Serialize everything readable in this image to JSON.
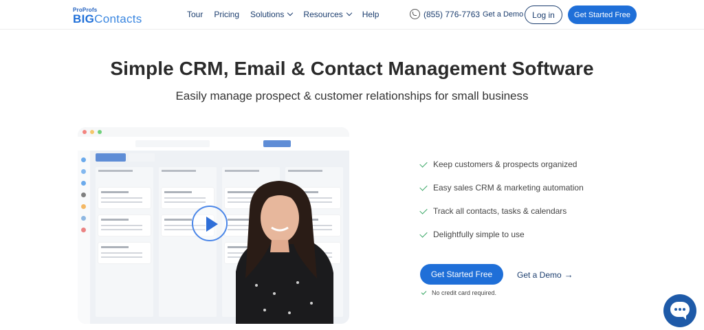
{
  "brand": {
    "top": "ProProfs",
    "big": "BIG",
    "rest": "Contacts"
  },
  "nav": {
    "items": [
      {
        "label": "Tour",
        "dropdown": false
      },
      {
        "label": "Pricing",
        "dropdown": false
      },
      {
        "label": "Solutions",
        "dropdown": true
      },
      {
        "label": "Resources",
        "dropdown": true
      },
      {
        "label": "Help",
        "dropdown": false
      }
    ],
    "phone": "(855) 776-7763",
    "demo": "Get a Demo",
    "login": "Log in",
    "start": "Get Started Free"
  },
  "hero": {
    "title": "Simple CRM, Email & Contact Management Software",
    "subtitle": "Easily manage prospect & customer relationships for small business"
  },
  "features": [
    "Keep customers & prospects organized",
    "Easy sales CRM & marketing automation",
    "Track all contacts, tasks & calendars",
    "Delightfully simple to use"
  ],
  "cta": {
    "start": "Get Started Free",
    "demo": "Get a Demo",
    "arrow": "→",
    "note": "No credit card required."
  },
  "colors": {
    "primary": "#1f6fd8",
    "nav_text": "#1b3d6e",
    "check": "#35a562",
    "chat": "#1e5aa8"
  },
  "icons": {
    "phone": "phone-icon",
    "play": "play-icon",
    "check": "checkmark-icon",
    "chat": "chat-bubble-icon",
    "chevron": "chevron-down-icon"
  }
}
